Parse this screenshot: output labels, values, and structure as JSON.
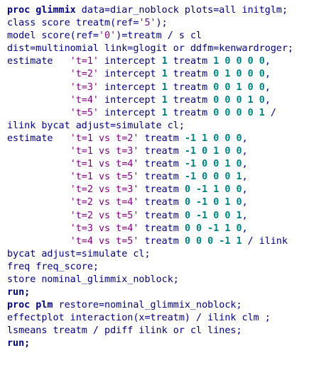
{
  "colors": {
    "keyword": "#000080",
    "plain": "#000080",
    "string": "#800080",
    "number": "#008080",
    "background": "#ffffff"
  },
  "code_lines": [
    [
      [
        "kw",
        "proc glimmix"
      ],
      [
        "plain",
        " data=diar_noblock plots=all initglm;"
      ]
    ],
    [
      [
        "plain",
        "class score treatm(ref="
      ],
      [
        "str",
        "'5'"
      ],
      [
        "plain",
        ");"
      ]
    ],
    [
      [
        "plain",
        "model score(ref="
      ],
      [
        "str",
        "'0'"
      ],
      [
        "plain",
        ")=treatm / s cl"
      ]
    ],
    [
      [
        "plain",
        "dist=multinomial link=glogit or ddfm=kenwardroger;"
      ]
    ],
    [
      [
        "plain",
        "estimate   "
      ],
      [
        "str",
        "'t=1'"
      ],
      [
        "plain",
        " intercept "
      ],
      [
        "num",
        "1"
      ],
      [
        "plain",
        " treatm "
      ],
      [
        "num",
        "1 0 0 0 0"
      ],
      [
        "plain",
        ","
      ]
    ],
    [
      [
        "plain",
        "           "
      ],
      [
        "str",
        "'t=2'"
      ],
      [
        "plain",
        " intercept "
      ],
      [
        "num",
        "1"
      ],
      [
        "plain",
        " treatm "
      ],
      [
        "num",
        "0 1 0 0 0"
      ],
      [
        "plain",
        ","
      ]
    ],
    [
      [
        "plain",
        "           "
      ],
      [
        "str",
        "'t=3'"
      ],
      [
        "plain",
        " intercept "
      ],
      [
        "num",
        "1"
      ],
      [
        "plain",
        " treatm "
      ],
      [
        "num",
        "0 0 1 0 0"
      ],
      [
        "plain",
        ","
      ]
    ],
    [
      [
        "plain",
        "           "
      ],
      [
        "str",
        "'t=4'"
      ],
      [
        "plain",
        " intercept "
      ],
      [
        "num",
        "1"
      ],
      [
        "plain",
        " treatm "
      ],
      [
        "num",
        "0 0 0 1 0"
      ],
      [
        "plain",
        ","
      ]
    ],
    [
      [
        "plain",
        "           "
      ],
      [
        "str",
        "'t=5'"
      ],
      [
        "plain",
        " intercept "
      ],
      [
        "num",
        "1"
      ],
      [
        "plain",
        " treatm "
      ],
      [
        "num",
        "0 0 0 0 1"
      ],
      [
        "plain",
        " /"
      ]
    ],
    [
      [
        "plain",
        "ilink bycat adjust=simulate cl;"
      ]
    ],
    [
      [
        "plain",
        "estimate   "
      ],
      [
        "str",
        "'t=1 vs t=2'"
      ],
      [
        "plain",
        " treatm "
      ],
      [
        "num",
        "-1 1 0 0 0"
      ],
      [
        "plain",
        ","
      ]
    ],
    [
      [
        "plain",
        "           "
      ],
      [
        "str",
        "'t=1 vs t=3'"
      ],
      [
        "plain",
        " treatm "
      ],
      [
        "num",
        "-1 0 1 0 0"
      ],
      [
        "plain",
        ","
      ]
    ],
    [
      [
        "plain",
        "           "
      ],
      [
        "str",
        "'t=1 vs t=4'"
      ],
      [
        "plain",
        " treatm "
      ],
      [
        "num",
        "-1 0 0 1 0"
      ],
      [
        "plain",
        ","
      ]
    ],
    [
      [
        "plain",
        "           "
      ],
      [
        "str",
        "'t=1 vs t=5'"
      ],
      [
        "plain",
        " treatm "
      ],
      [
        "num",
        "-1 0 0 0 1"
      ],
      [
        "plain",
        ","
      ]
    ],
    [
      [
        "plain",
        "           "
      ],
      [
        "str",
        "'t=2 vs t=3'"
      ],
      [
        "plain",
        " treatm "
      ],
      [
        "num",
        "0 -1 1 0 0"
      ],
      [
        "plain",
        ","
      ]
    ],
    [
      [
        "plain",
        "           "
      ],
      [
        "str",
        "'t=2 vs t=4'"
      ],
      [
        "plain",
        " treatm "
      ],
      [
        "num",
        "0 -1 0 1 0"
      ],
      [
        "plain",
        ","
      ]
    ],
    [
      [
        "plain",
        "           "
      ],
      [
        "str",
        "'t=2 vs t=5'"
      ],
      [
        "plain",
        " treatm "
      ],
      [
        "num",
        "0 -1 0 0 1"
      ],
      [
        "plain",
        ","
      ]
    ],
    [
      [
        "plain",
        "           "
      ],
      [
        "str",
        "'t=3 vs t=4'"
      ],
      [
        "plain",
        " treatm "
      ],
      [
        "num",
        "0 0 -1 1 0"
      ],
      [
        "plain",
        ","
      ]
    ],
    [
      [
        "plain",
        "           "
      ],
      [
        "str",
        "'t=4 vs t=5'"
      ],
      [
        "plain",
        " treatm "
      ],
      [
        "num",
        "0 0 0 -1 1"
      ],
      [
        "plain",
        " / ilink"
      ]
    ],
    [
      [
        "plain",
        "bycat adjust=simulate cl;"
      ]
    ],
    [
      [
        "plain",
        "freq freq_score;"
      ]
    ],
    [
      [
        "plain",
        "store nominal_glimmix_noblock;"
      ]
    ],
    [
      [
        "kw",
        "run;"
      ]
    ],
    [
      [
        "kw",
        "proc plm"
      ],
      [
        "plain",
        " restore=nominal_glimmix_noblock;"
      ]
    ],
    [
      [
        "plain",
        "effectplot interaction(x=treatm) / ilink clm ;"
      ]
    ],
    [
      [
        "plain",
        "lsmeans treatm / pdiff ilink or cl lines;"
      ]
    ],
    [
      [
        "kw",
        "run;"
      ]
    ]
  ]
}
